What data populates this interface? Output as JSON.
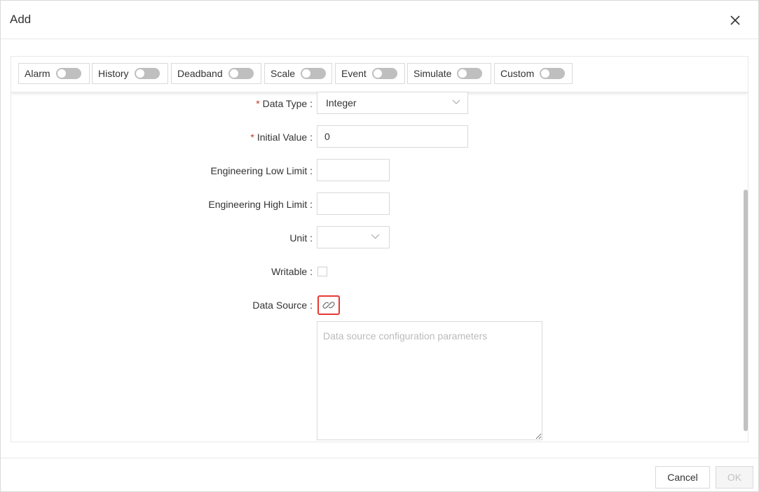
{
  "dialog": {
    "title": "Add"
  },
  "toggles": [
    {
      "label": "Alarm",
      "on": false
    },
    {
      "label": "History",
      "on": false
    },
    {
      "label": "Deadband",
      "on": false
    },
    {
      "label": "Scale",
      "on": false
    },
    {
      "label": "Event",
      "on": false
    },
    {
      "label": "Simulate",
      "on": false
    },
    {
      "label": "Custom",
      "on": false
    }
  ],
  "form": {
    "data_type": {
      "label": "Data Type :",
      "required": true,
      "value": "Integer"
    },
    "initial_value": {
      "label": "Initial Value :",
      "required": true,
      "value": "0"
    },
    "eng_low": {
      "label": "Engineering Low Limit :",
      "value": ""
    },
    "eng_high": {
      "label": "Engineering High Limit :",
      "value": ""
    },
    "unit": {
      "label": "Unit :",
      "value": ""
    },
    "writable": {
      "label": "Writable :",
      "checked": false
    },
    "data_source": {
      "label": "Data Source :",
      "placeholder": "Data source configuration parameters"
    }
  },
  "footer": {
    "cancel_label": "Cancel",
    "ok_label": "OK"
  },
  "colors": {
    "required_asterisk": "#c0392b",
    "highlight_border": "#e53935",
    "switch_off": "#bfbfbf"
  }
}
